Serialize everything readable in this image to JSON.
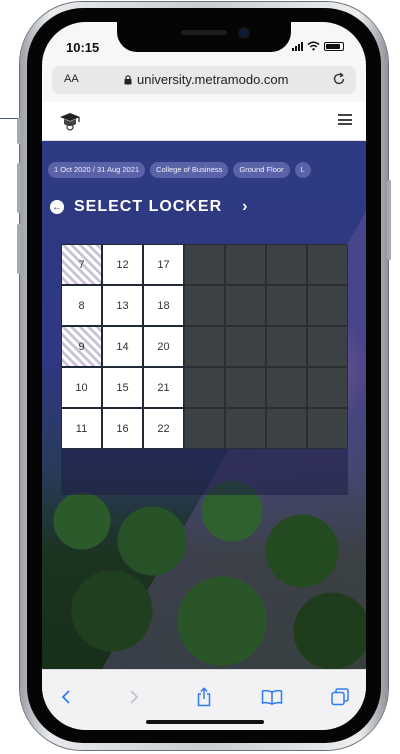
{
  "status_bar": {
    "time": "10:15"
  },
  "browser": {
    "text_size_label": "AA",
    "url": "university.metramodo.com"
  },
  "filters": [
    {
      "label": "1 Oct 2020 / 31 Aug 2021"
    },
    {
      "label": "College of Business"
    },
    {
      "label": "Ground Floor"
    },
    {
      "label": "L"
    }
  ],
  "locker_page": {
    "heading": "SELECT LOCKER"
  },
  "locker_grid": {
    "rows": [
      [
        {
          "number": "7",
          "state": "taken"
        },
        {
          "number": "12",
          "state": "available"
        },
        {
          "number": "17",
          "state": "available"
        },
        {
          "number": "",
          "state": "unavailable"
        },
        {
          "number": "",
          "state": "unavailable"
        },
        {
          "number": "",
          "state": "unavailable"
        },
        {
          "number": "",
          "state": "unavailable"
        }
      ],
      [
        {
          "number": "8",
          "state": "available"
        },
        {
          "number": "13",
          "state": "available"
        },
        {
          "number": "18",
          "state": "available"
        },
        {
          "number": "",
          "state": "unavailable"
        },
        {
          "number": "",
          "state": "unavailable"
        },
        {
          "number": "",
          "state": "unavailable"
        },
        {
          "number": "",
          "state": "unavailable"
        }
      ],
      [
        {
          "number": "9",
          "state": "taken"
        },
        {
          "number": "14",
          "state": "available"
        },
        {
          "number": "20",
          "state": "available"
        },
        {
          "number": "",
          "state": "unavailable"
        },
        {
          "number": "",
          "state": "unavailable"
        },
        {
          "number": "",
          "state": "unavailable"
        },
        {
          "number": "",
          "state": "unavailable"
        }
      ],
      [
        {
          "number": "10",
          "state": "available"
        },
        {
          "number": "15",
          "state": "available"
        },
        {
          "number": "21",
          "state": "available"
        },
        {
          "number": "",
          "state": "unavailable"
        },
        {
          "number": "",
          "state": "unavailable"
        },
        {
          "number": "",
          "state": "unavailable"
        },
        {
          "number": "",
          "state": "unavailable"
        }
      ],
      [
        {
          "number": "11",
          "state": "available"
        },
        {
          "number": "16",
          "state": "available"
        },
        {
          "number": "22",
          "state": "available"
        },
        {
          "number": "",
          "state": "unavailable"
        },
        {
          "number": "",
          "state": "unavailable"
        },
        {
          "number": "",
          "state": "unavailable"
        },
        {
          "number": "",
          "state": "unavailable"
        }
      ]
    ]
  },
  "icons": {
    "lock": "lock-icon",
    "reload": "reload-icon",
    "logo": "graduation-cap-logo",
    "menu": "hamburger-menu-icon",
    "back": "arrow-left-circle-icon",
    "next": "chevron-right-icon",
    "toolbar": [
      "chevron-left-icon",
      "chevron-right-icon",
      "share-icon",
      "bookmarks-icon",
      "tabs-icon"
    ]
  },
  "colors": {
    "brand_blue": "#2e3a82",
    "chip_bg": "#5a63a8",
    "available": "#ffffff",
    "unavailable": "#3c4146",
    "ios_blue": "#2f7cf6"
  }
}
